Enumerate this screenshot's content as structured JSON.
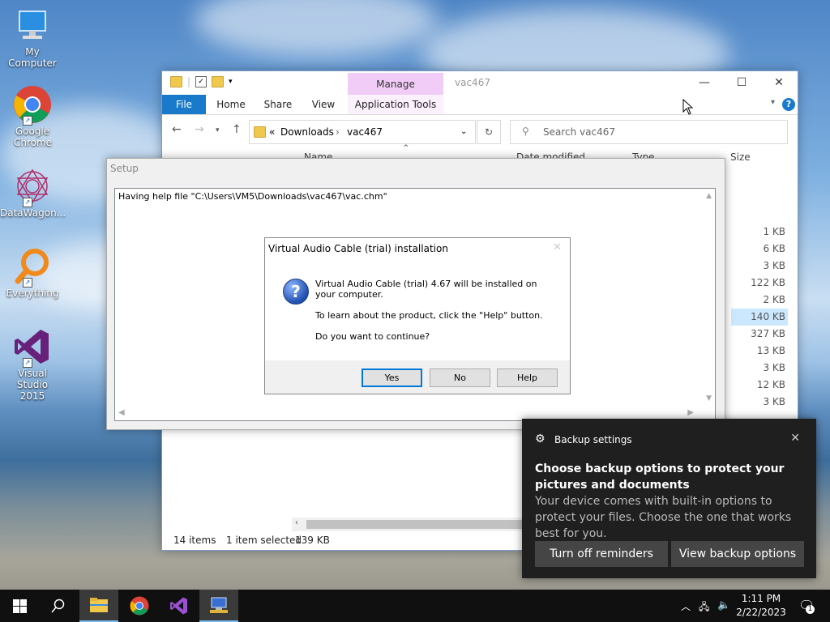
{
  "desktop": {
    "icons": [
      {
        "label": "My Computer",
        "icon": "monitor-icon"
      },
      {
        "label": "Google Chrome",
        "icon": "chrome-icon"
      },
      {
        "label": "DataWagon...",
        "icon": "datawagon-icon"
      },
      {
        "label": "Everything",
        "icon": "everything-icon"
      },
      {
        "label": "Visual Studio 2015",
        "icon": "visual-studio-icon"
      }
    ]
  },
  "explorer": {
    "context_tab": "Manage",
    "title": "vac467",
    "tabs": [
      "File",
      "Home",
      "Share",
      "View",
      "Application Tools"
    ],
    "breadcrumb": {
      "prefix": "«",
      "items": [
        "Downloads",
        "vac467"
      ]
    },
    "search_placeholder": "Search vac467",
    "columns": {
      "name": "Name",
      "date": "Date modified",
      "type": "Type",
      "size": "Size"
    },
    "sizes": [
      "1 KB",
      "6 KB",
      "3 KB",
      "122 KB",
      "2 KB",
      "140 KB",
      "327 KB",
      "13 KB",
      "3 KB",
      "12 KB",
      "3 KB"
    ],
    "selected_index": 5,
    "status": {
      "count": "14 items",
      "selection": "1 item selected",
      "size": "139 KB"
    }
  },
  "setup": {
    "title": "Setup",
    "log_text": "Having help file \"C:\\Users\\VM5\\Downloads\\vac467\\vac.chm\""
  },
  "dialog": {
    "title": "Virtual Audio Cable (trial) installation",
    "msg1": "Virtual Audio Cable (trial) 4.67 will be installed on your computer.",
    "msg2": "To learn about the product, click the \"Help\" button.",
    "msg3": "Do you want to continue?",
    "yes": "Yes",
    "no": "No",
    "help": "Help"
  },
  "toast": {
    "app": "Backup settings",
    "heading": "Choose backup options to protect your pictures and documents",
    "body": "Your device comes with built-in options to protect your files. Choose the one that works best for you.",
    "btn_off": "Turn off reminders",
    "btn_view": "View backup options"
  },
  "taskbar": {
    "time": "1:11 PM",
    "date": "2/22/2023",
    "notification_count": "1"
  }
}
